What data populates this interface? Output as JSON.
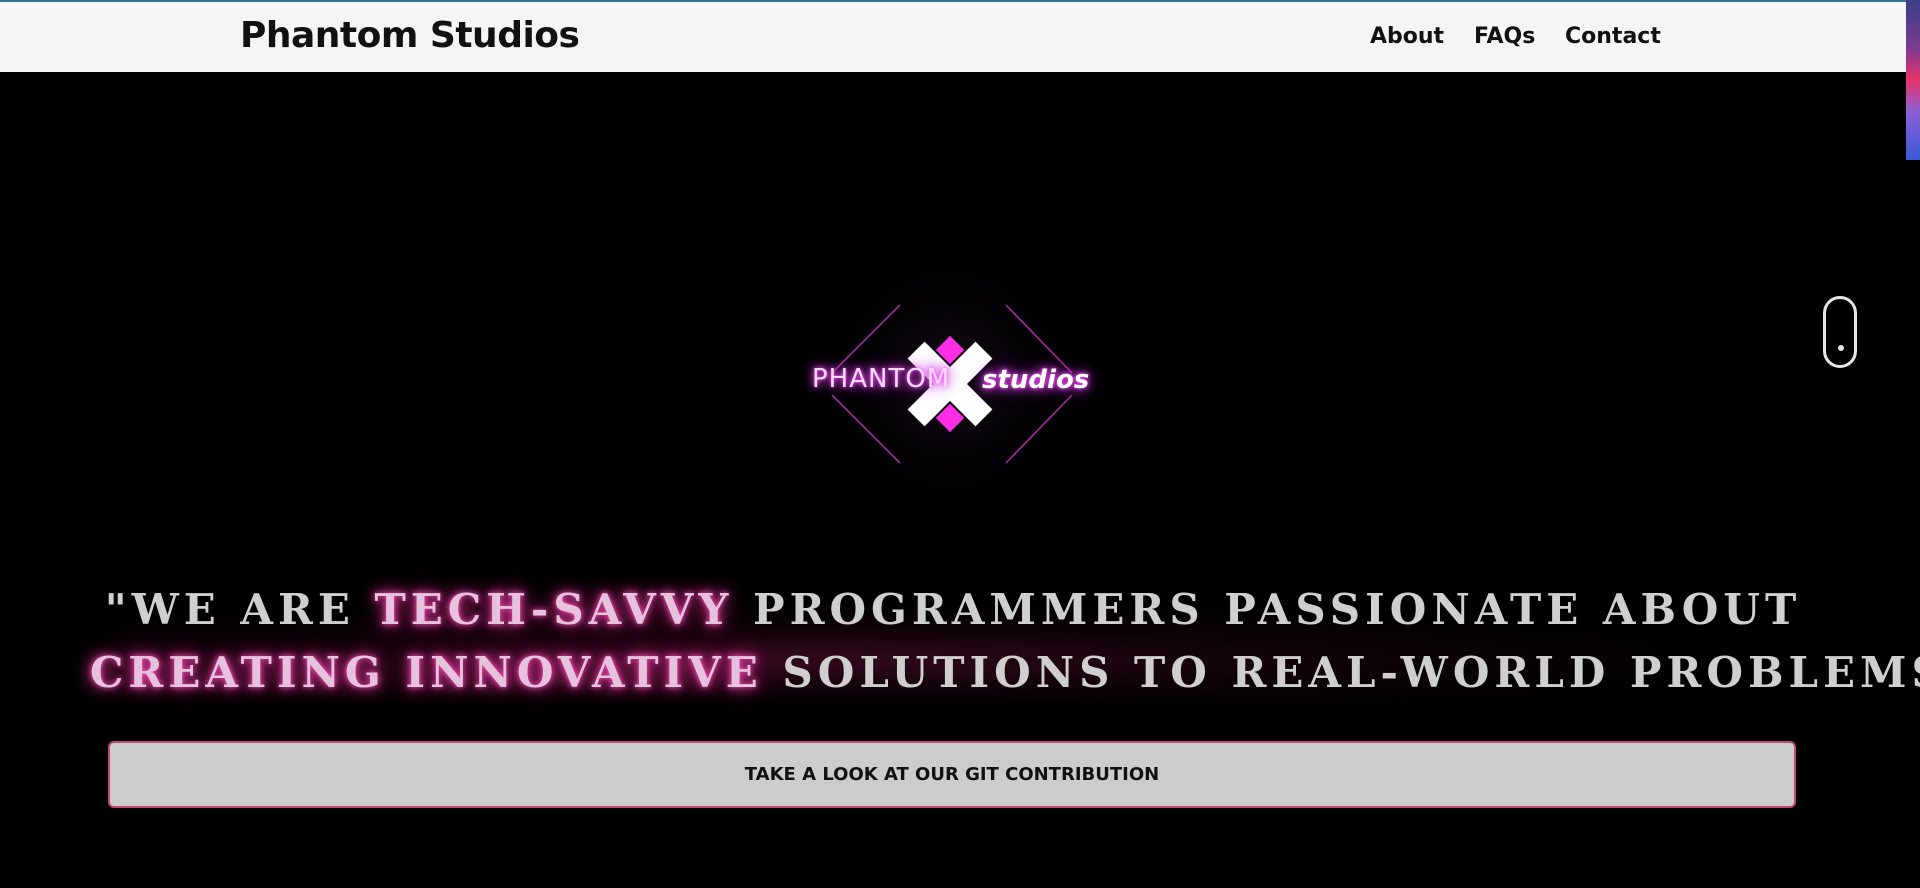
{
  "navbar": {
    "brand": "Phantom Studios",
    "links": [
      {
        "label": "About"
      },
      {
        "label": "FAQs"
      },
      {
        "label": "Contact"
      }
    ]
  },
  "logo": {
    "word_left": "PHANTOM",
    "word_right": "studios"
  },
  "headline": {
    "line1_pre": "\"We are ",
    "line1_glow": "tech-savvy",
    "line1_post": " programmers passionate about",
    "line2_glow": "creating innovative",
    "line2_post": " solutions to real-world problems."
  },
  "cta": {
    "label": "TAKE A LOOK AT OUR GIT CONTRIBUTION"
  },
  "colors": {
    "navbar_bg": "#f5f5f5",
    "page_bg": "#000000",
    "neon_pink": "#ff3dd6",
    "button_bg": "#cccccc",
    "button_border": "#c04878"
  },
  "icons": {
    "scroll_indicator": "mouse-scroll-icon",
    "logo_mark": "x-mark-icon"
  }
}
